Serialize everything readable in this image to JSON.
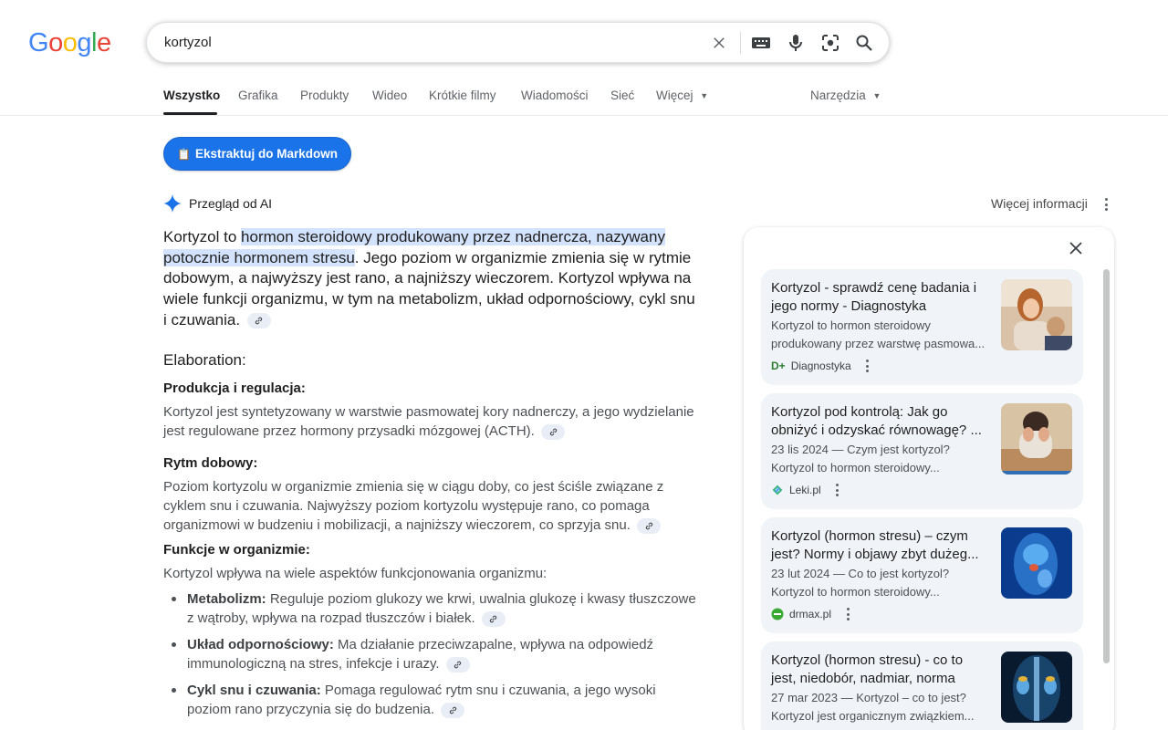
{
  "logo": {
    "letters": [
      "G",
      "o",
      "o",
      "g",
      "l",
      "e"
    ],
    "colors": [
      "#4285F4",
      "#EA4335",
      "#FBBC05",
      "#4285F4",
      "#34A853",
      "#EA4335"
    ]
  },
  "search": {
    "query": "kortyzol",
    "icons": [
      "close-icon",
      "keyboard-icon",
      "mic-icon",
      "lens-icon",
      "search-icon"
    ]
  },
  "tabs": [
    {
      "label": "Wszystko",
      "active": true
    },
    {
      "label": "Grafika"
    },
    {
      "label": "Produkty"
    },
    {
      "label": "Wideo"
    },
    {
      "label": "Krótkie filmy"
    },
    {
      "label": "Wiadomości"
    },
    {
      "label": "Sieć"
    },
    {
      "label": "Więcej"
    }
  ],
  "tools_label": "Narzędzia",
  "extract_button": {
    "icon": "📋",
    "label": "Ekstraktuj do Markdown"
  },
  "ai": {
    "heading": "Przegląd od AI",
    "more_info": "Więcej informacji",
    "lead_pre": "Kortyzol to ",
    "lead_hl": "hormon steroidowy produkowany przez nadnercza, nazywany potocznie hormonem stresu",
    "lead_post": ". Jego poziom w organizmie zmienia się w rytmie dobowym, a najwyższy jest rano, a najniższy wieczorem. Kortyzol wpływa na wiele funkcji organizmu, w tym na metabolizm, układ odpornościowy, cykl snu i czuwania.",
    "elaboration": "Elaboration:",
    "sections": [
      {
        "title": "Produkcja i regulacja:",
        "text": "Kortyzol jest syntetyzowany w warstwie pasmowatej kory nadnerczy, a jego wydzielanie jest regulowane przez hormony przysadki mózgowej (ACTH)."
      },
      {
        "title": "Rytm dobowy:",
        "text": "Poziom kortyzolu w organizmie zmienia się w ciągu doby, co jest ściśle związane z cyklem snu i czuwania. Najwyższy poziom kortyzolu występuje rano, co pomaga organizmowi w budzeniu i mobilizacji, a najniższy wieczorem, co sprzyja snu."
      },
      {
        "title": "Funkcje w organizmie:",
        "text": "Kortyzol wpływa na wiele aspektów funkcjonowania organizmu:"
      }
    ],
    "bullets": [
      {
        "bold": "Metabolizm:",
        "text": " Reguluje poziom glukozy we krwi, uwalnia glukozę i kwasy tłuszczowe z wątroby, wpływa na rozpad tłuszczów i białek."
      },
      {
        "bold": "Układ odpornościowy:",
        "text": " Ma działanie przeciwzapalne, wpływa na odpowiedź immunologiczną na stres, infekcje i urazy."
      },
      {
        "bold": "Cykl snu i czuwania:",
        "text": " Pomaga regulować rytm snu i czuwania, a jego wysoki poziom rano przyczynia się do budzenia."
      }
    ]
  },
  "sources": [
    {
      "title": "Kortyzol - sprawdź cenę badania i jego normy - Diagnostyka",
      "desc": "Kortyzol to hormon steroidowy produkowany przez warstwę pasmowa...",
      "site": "Diagnostyka",
      "favicon": "D+"
    },
    {
      "title": "Kortyzol pod kontrolą: Jak go obniżyć i odzyskać równowagę? ...",
      "desc": "23 lis 2024 — Czym jest kortyzol? Kortyzol to hormon steroidowy...",
      "site": "Leki.pl",
      "favicon": "leki"
    },
    {
      "title": "Kortyzol (hormon stresu) – czym jest? Normy i objawy zbyt dużeg...",
      "desc": "23 lut 2024 — Co to jest kortyzol? Kortyzol to hormon steroidowy...",
      "site": "drmax.pl",
      "favicon": "drmax"
    },
    {
      "title": "Kortyzol (hormon stresu) - co to jest, niedobór, nadmiar, norma",
      "desc": "27 mar 2023 — Kortyzol – co to jest? Kortyzol jest organicznym związkiem...",
      "site": "",
      "favicon": ""
    }
  ]
}
